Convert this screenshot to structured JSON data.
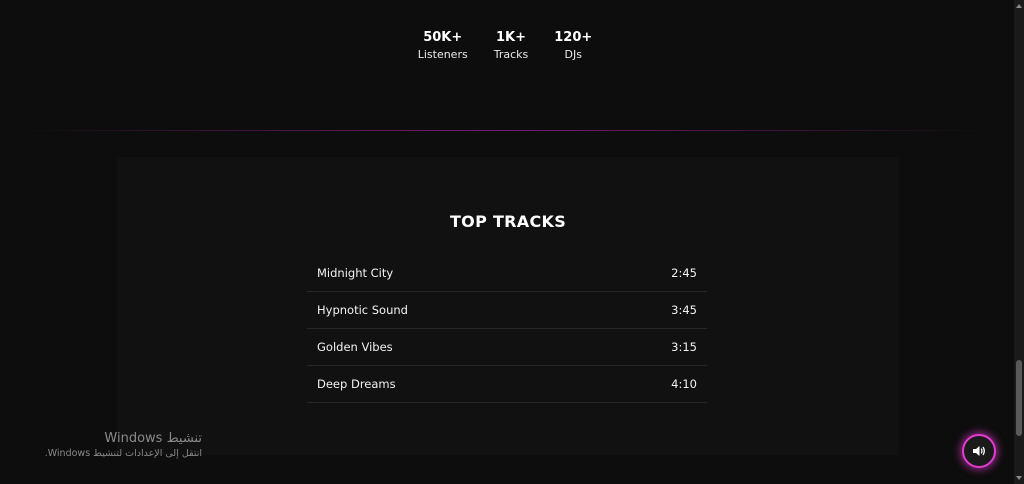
{
  "stats": [
    {
      "value": "50K+",
      "label": "Listeners"
    },
    {
      "value": "1K+",
      "label": "Tracks"
    },
    {
      "value": "120+",
      "label": "DJs"
    }
  ],
  "top_tracks": {
    "title": "TOP TRACKS",
    "tracks": [
      {
        "name": "Midnight City",
        "duration": "2:45"
      },
      {
        "name": "Hypnotic Sound",
        "duration": "3:45"
      },
      {
        "name": "Golden Vibes",
        "duration": "3:15"
      },
      {
        "name": "Deep Dreams",
        "duration": "4:10"
      }
    ]
  },
  "watermark": {
    "title": "تنشيط Windows",
    "subtitle": "انتقل إلى الإعدادات لتنشيط Windows."
  },
  "sound_button": {
    "icon": "speaker-icon"
  },
  "colors": {
    "background": "#0d0d0d",
    "card": "#111111",
    "accent": "#e23bd0",
    "text": "#ffffff"
  }
}
